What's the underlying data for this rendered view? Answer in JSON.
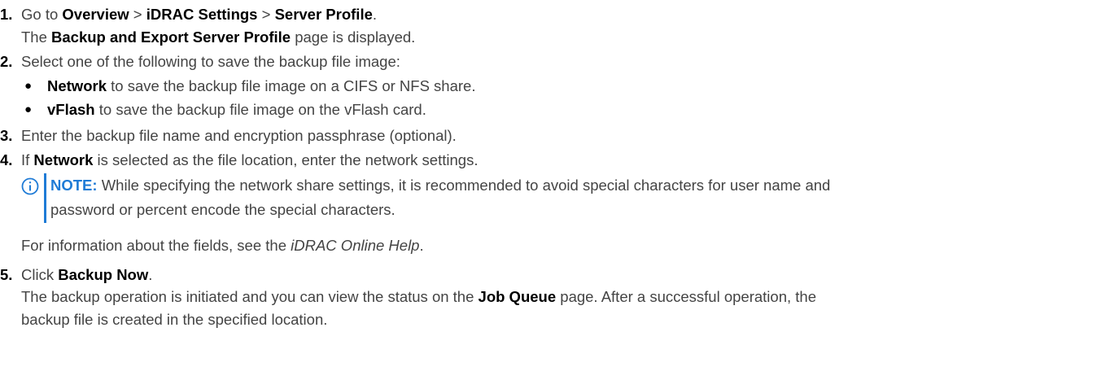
{
  "steps": [
    {
      "number": "1.",
      "segments": [
        {
          "t": "Go to ",
          "b": false
        },
        {
          "t": "Overview",
          "b": true
        },
        {
          "t": " > ",
          "b": false
        },
        {
          "t": "iDRAC Settings",
          "b": true
        },
        {
          "t": " > ",
          "b": false
        },
        {
          "t": "Server Profile",
          "b": true
        },
        {
          "t": ".",
          "b": false
        }
      ],
      "result": [
        {
          "t": "The ",
          "b": false
        },
        {
          "t": "Backup and Export Server Profile",
          "b": true
        },
        {
          "t": " page is displayed.",
          "b": false
        }
      ]
    },
    {
      "number": "2.",
      "segments": [
        {
          "t": "Select one of the following to save the backup file image:",
          "b": false
        }
      ],
      "bullets": [
        [
          {
            "t": "Network",
            "b": true
          },
          {
            "t": " to save the backup file image on a CIFS or NFS share.",
            "b": false
          }
        ],
        [
          {
            "t": "vFlash",
            "b": true
          },
          {
            "t": " to save the backup file image on the vFlash card.",
            "b": false
          }
        ]
      ]
    },
    {
      "number": "3.",
      "segments": [
        {
          "t": "Enter the backup file name and encryption passphrase (optional).",
          "b": false
        }
      ]
    },
    {
      "number": "4.",
      "segments": [
        {
          "t": "If ",
          "b": false
        },
        {
          "t": "Network",
          "b": true
        },
        {
          "t": " is selected as the file location, enter the network settings.",
          "b": false
        }
      ],
      "note": {
        "label": "NOTE:",
        "line1": " While specifying the network share settings, it is recommended to avoid special characters for user name and",
        "line2": "password or percent encode the special characters."
      },
      "after": [
        {
          "t": "For information about the fields, see the ",
          "b": false
        },
        {
          "t": "iDRAC Online Help",
          "i": true
        },
        {
          "t": ".",
          "b": false
        }
      ]
    },
    {
      "number": "5.",
      "segments": [
        {
          "t": "Click ",
          "b": false
        },
        {
          "t": "Backup Now",
          "b": true
        },
        {
          "t": ".",
          "b": false
        }
      ],
      "result_line1": [
        {
          "t": "The backup operation is initiated and you can view the status on the ",
          "b": false
        },
        {
          "t": "Job Queue",
          "b": true
        },
        {
          "t": " page. After a successful operation, the",
          "b": false
        }
      ],
      "result_line2": "backup file is created in the specified location."
    }
  ],
  "icons": {
    "note": "info-circle-icon"
  },
  "colors": {
    "text": "#444444",
    "bold": "#000000",
    "note_accent": "#1f7bd6"
  }
}
